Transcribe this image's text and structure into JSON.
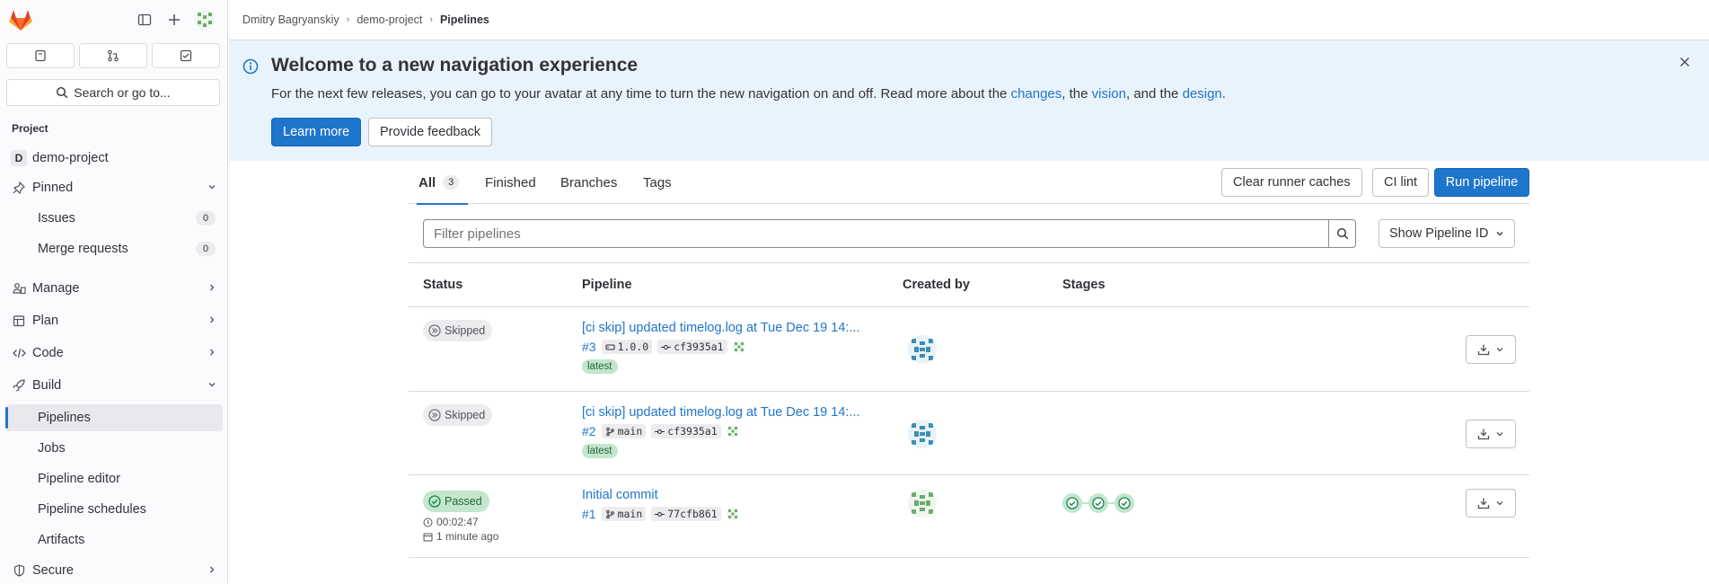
{
  "colors": {
    "accent": "#1f75cb",
    "success": "#108548",
    "banner_bg": "#e9f3fc"
  },
  "sidebar": {
    "search_label": "Search or go to...",
    "section_title": "Project",
    "project_initial": "D",
    "project_name": "demo-project",
    "pinned": "Pinned",
    "issues": "Issues",
    "issues_count": "0",
    "merge_requests": "Merge requests",
    "merge_requests_count": "0",
    "manage": "Manage",
    "plan": "Plan",
    "code": "Code",
    "build": "Build",
    "pipelines": "Pipelines",
    "jobs": "Jobs",
    "pipeline_editor": "Pipeline editor",
    "pipeline_schedules": "Pipeline schedules",
    "artifacts": "Artifacts",
    "secure": "Secure"
  },
  "breadcrumb": {
    "user": "Dmitry Bagryanskiy",
    "project": "demo-project",
    "current": "Pipelines"
  },
  "banner": {
    "title": "Welcome to a new navigation experience",
    "text_1": "For the next few releases, you can go to your avatar at any time to turn the new navigation on and off. Read more about the ",
    "link_changes": "changes",
    "text_2": ", the ",
    "link_vision": "vision",
    "text_3": ", and the ",
    "link_design": "design",
    "text_4": ".",
    "learn_more": "Learn more",
    "feedback": "Provide feedback"
  },
  "tabs": {
    "all": "All",
    "all_count": "3",
    "finished": "Finished",
    "branches": "Branches",
    "tags": "Tags"
  },
  "actions": {
    "clear_caches": "Clear runner caches",
    "ci_lint": "CI lint",
    "run_pipeline": "Run pipeline"
  },
  "filter": {
    "placeholder": "Filter pipelines",
    "show_id": "Show Pipeline ID"
  },
  "table": {
    "headers": {
      "status": "Status",
      "pipeline": "Pipeline",
      "created_by": "Created by",
      "stages": "Stages"
    },
    "rows": [
      {
        "status": "Skipped",
        "title": "[ci skip] updated timelog.log at Tue Dec 19 14:...",
        "id": "#3",
        "ref": "1.0.0",
        "ref_icon": "tag-icon",
        "sha": "cf3935a1",
        "badge": "latest"
      },
      {
        "status": "Skipped",
        "title": "[ci skip] updated timelog.log at Tue Dec 19 14:...",
        "id": "#2",
        "ref": "main",
        "ref_icon": "branch-icon",
        "sha": "cf3935a1",
        "badge": "latest"
      },
      {
        "status": "Passed",
        "title": "Initial commit",
        "id": "#1",
        "ref": "main",
        "ref_icon": "branch-icon",
        "sha": "77cfb861",
        "duration": "00:02:47",
        "finished": "1 minute ago",
        "stages": 3
      }
    ]
  }
}
